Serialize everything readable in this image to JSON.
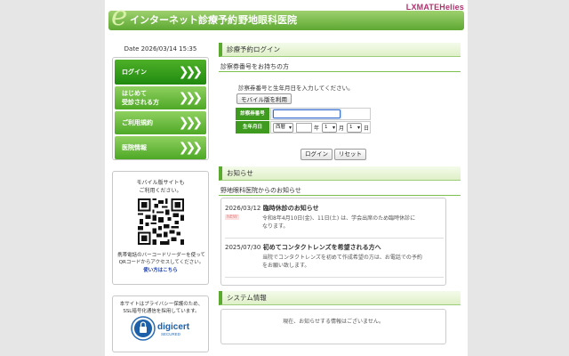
{
  "header": {
    "brand": "LXMATEHelies",
    "banner_title": "インターネット診療予約",
    "clinic_name": "野地眼科医院"
  },
  "sidebar": {
    "date": "Date 2026/03/14 15:35",
    "items": [
      {
        "label": "ログイン"
      },
      {
        "label": "はじめて\n受診される方"
      },
      {
        "label": "ご利用規約"
      },
      {
        "label": "医院情報"
      }
    ],
    "mobile_text": "モバイル版サイトも\nご利用ください。",
    "mobile_desc": "携帯電話のバーコードリーダーを使って\nQRコードからアクセスしてください。",
    "mobile_link": "使い方はこちら",
    "security_text": "本サイトはプライバシー保護のため、\nSSL暗号化通信を採用しています。",
    "digicert_name": "digicert",
    "digicert_sub": "SECURED"
  },
  "login": {
    "title": "診療予約ログイン",
    "subtitle": "診察券番号をお持ちの方",
    "instruction": "診察券番号と生年月日を入力してください。",
    "mobile_button": "モバイル版を利用",
    "card_label": "診察券番号",
    "card_value": "",
    "birth_label": "生年月日",
    "era_value": "西暦",
    "year_suffix": "年",
    "month_value": "1",
    "month_suffix": "月",
    "day_value": "1",
    "day_suffix": "日",
    "login_button": "ログイン",
    "reset_button": "リセット"
  },
  "news": {
    "title": "お知らせ",
    "subtitle": "野地眼科医院からのお知らせ",
    "items": [
      {
        "date": "2026/03/12",
        "headline": "臨時休診のお知らせ",
        "badge": "NEW",
        "body": "令和8年4月10日(金)、11日(土) は、学会出席のため臨時休診に\nなります。"
      },
      {
        "date": "2025/07/30",
        "headline": "初めてコンタクトレンズを希望される方へ",
        "badge": "",
        "body": "当院でコンタクトレンズを初めて作成希望の方は、お電話での予約\nをお願い致します。"
      }
    ]
  },
  "system": {
    "title": "システム情報",
    "message": "現在、お知らせする情報はございません。"
  },
  "colors": {
    "primary_green": "#4ea826",
    "banner_green": "#5da832",
    "brand_pink": "#b0306c",
    "link_blue": "#1a3da8"
  }
}
